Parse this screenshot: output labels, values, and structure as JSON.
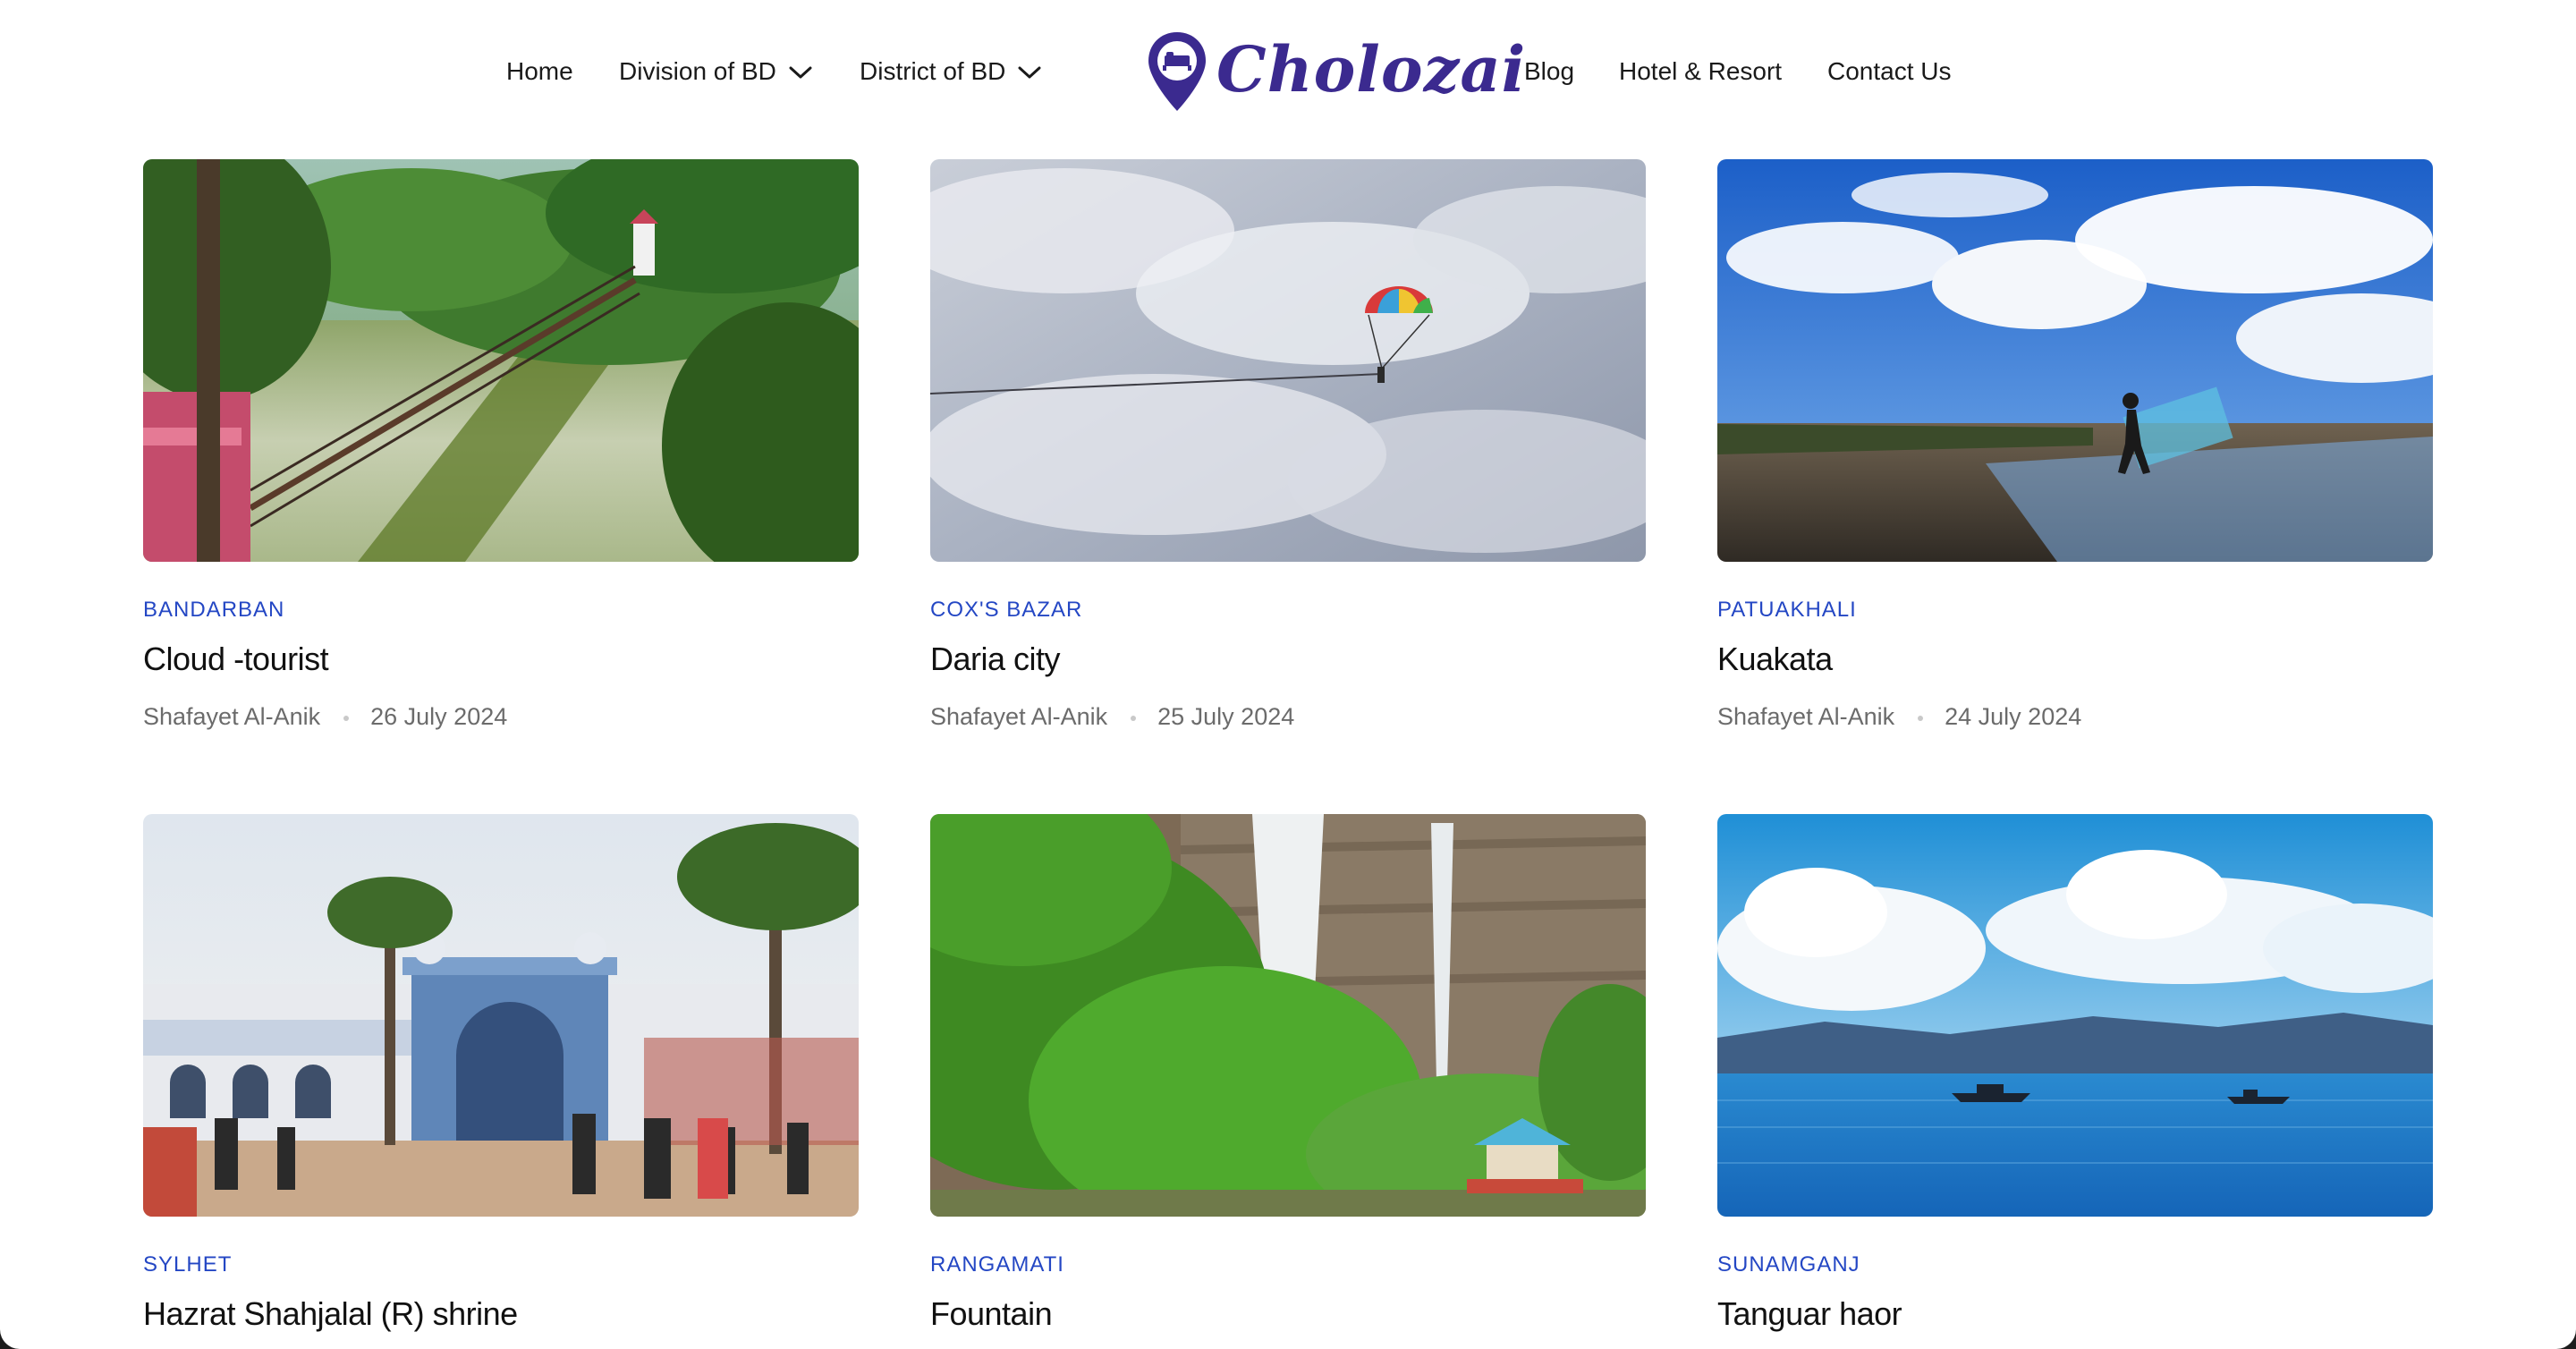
{
  "header": {
    "logo_text": "Cholozai",
    "nav_left": [
      {
        "label": "Home"
      },
      {
        "label": "Division of BD"
      },
      {
        "label": "District of BD"
      }
    ],
    "nav_right": [
      {
        "label": "Blog"
      },
      {
        "label": "Hotel & Resort"
      },
      {
        "label": "Contact Us"
      }
    ]
  },
  "posts": [
    {
      "category": "BANDARBAN",
      "title": "Cloud -tourist",
      "author": "Shafayet Al-Anik",
      "date": "26 July 2024",
      "image": "hanging-bridge-over-lake-image"
    },
    {
      "category": "COX'S BAZAR",
      "title": "Daria city",
      "author": "Shafayet Al-Anik",
      "date": "25 July 2024",
      "image": "parasailing-sky-image"
    },
    {
      "category": "PATUAKHALI",
      "title": "Kuakata",
      "author": "Shafayet Al-Anik",
      "date": "24 July 2024",
      "image": "beach-fisherman-image"
    },
    {
      "category": "SYLHET",
      "title": "Hazrat Shahjalal (R) shrine",
      "author": "",
      "date": "",
      "image": "shrine-gate-image"
    },
    {
      "category": "RANGAMATI",
      "title": "Fountain",
      "author": "",
      "date": "",
      "image": "waterfall-forest-image"
    },
    {
      "category": "SUNAMGANJ",
      "title": "Tanguar haor",
      "author": "",
      "date": "",
      "image": "haor-lake-image"
    }
  ],
  "colors": {
    "accent": "#2447c4",
    "logo": "#3b2a8f",
    "text": "#111111",
    "meta": "#6b6b6b"
  }
}
